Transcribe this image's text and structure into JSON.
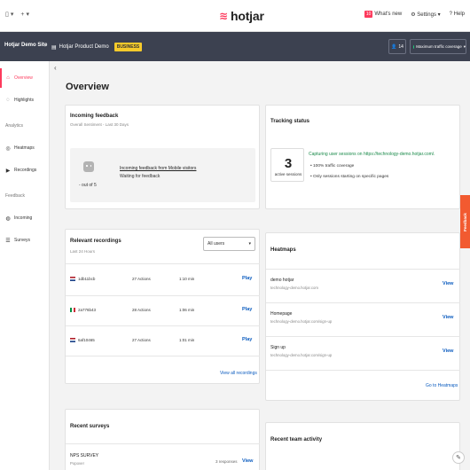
{
  "topbar": {
    "logo": "hotjar",
    "whats_new": "What's new",
    "whats_new_badge": "10",
    "settings": "Settings",
    "help": "Help"
  },
  "sitebar": {
    "site": "Hotjar Demo Site",
    "project": "Hotjar Product Demo",
    "plan_badge": "BUSINESS",
    "users_count": "14",
    "traffic": "Maximum traffic coverage"
  },
  "sidebar": {
    "items": [
      {
        "label": "Overview"
      },
      {
        "label": "Highlights"
      },
      {
        "label": "Heatmaps"
      },
      {
        "label": "Recordings"
      },
      {
        "label": "Incoming"
      },
      {
        "label": "Surveys"
      }
    ],
    "sections": {
      "analytics": "Analytics",
      "feedback": "Feedback"
    }
  },
  "page": {
    "title": "Overview"
  },
  "incoming_feedback": {
    "title": "Incoming feedback",
    "subtitle": "Overall Sentiment - Last 30 Days",
    "score": "- out of 5",
    "link": "Incoming feedback from Mobile visitors",
    "status": "Waiting for feedback"
  },
  "tracking": {
    "title": "Tracking status",
    "sessions": "3",
    "sessions_label": "active sessions",
    "capturing": "Capturing user sessions on https://technology-demo.hotjar.com/.",
    "bullets": [
      "• 100% traffic coverage",
      "• Only sessions starting on specific pages"
    ]
  },
  "recordings": {
    "title": "Relevant recordings",
    "subtitle": "Last 24 Hours",
    "filter": "All users",
    "rows": [
      {
        "id": "1db11bcb",
        "actions": "27 Actions",
        "duration": "1:10 min",
        "play": "Play"
      },
      {
        "id": "2a776b43",
        "actions": "28 Actions",
        "duration": "1:06 min",
        "play": "Play"
      },
      {
        "id": "6af10465",
        "actions": "27 Actions",
        "duration": "1:01 min",
        "play": "Play"
      }
    ],
    "view_all": "View all recordings"
  },
  "heatmaps": {
    "title": "Heatmaps",
    "rows": [
      {
        "name": "demo hotjar",
        "url": "technology-demo.hotjar.com",
        "view": "View"
      },
      {
        "name": "Homepage",
        "url": "technology-demo.hotjar.com/sign-up",
        "view": "View"
      },
      {
        "name": "Sign up",
        "url": "technology-demo.hotjar.com/sign-up",
        "view": "View"
      }
    ],
    "goto": "Go to Heatmaps"
  },
  "surveys": {
    "title": "Recent surveys",
    "row": {
      "name": "NPS SURVEY",
      "sub": "Popover",
      "responses": "3 responses",
      "view": "View"
    }
  },
  "team": {
    "title": "Recent team activity"
  },
  "feedback_tab": "Feedback",
  "colors": {
    "accent": "#fd3a5c",
    "link": "#0a5bbf",
    "sitebar": "#3c4150",
    "badge": "#f6ca2b",
    "feedback_tab": "#f25a30"
  }
}
